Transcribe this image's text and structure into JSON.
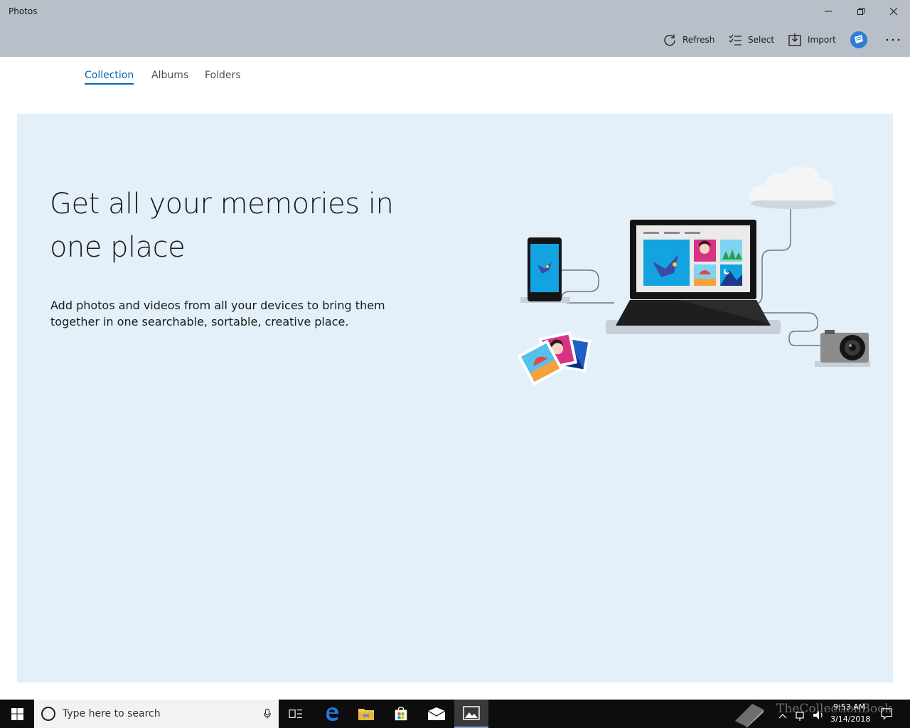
{
  "window": {
    "title": "Photos"
  },
  "toolbar": {
    "refresh_label": "Refresh",
    "select_label": "Select",
    "import_label": "Import"
  },
  "tabs": [
    {
      "label": "Collection",
      "active": true
    },
    {
      "label": "Albums",
      "active": false
    },
    {
      "label": "Folders",
      "active": false
    }
  ],
  "hero": {
    "heading": "Get all your memories in one place",
    "description": "Add photos and videos from all your devices to bring them together in one searchable, sortable, creative place."
  },
  "taskbar": {
    "search_placeholder": "Type here to search",
    "apps": [
      "task-view-icon",
      "edge-icon",
      "file-explorer-icon",
      "store-icon",
      "mail-icon",
      "photos-icon"
    ],
    "clock_time": "9:53 AM",
    "clock_date": "3/14/2018",
    "watermark": "TheCollectionBook"
  },
  "colors": {
    "titlebar": "#b8bfc9",
    "accent": "#0067b8",
    "hero_background": "#e3eff9",
    "taskbar": "#0d0d0d"
  }
}
